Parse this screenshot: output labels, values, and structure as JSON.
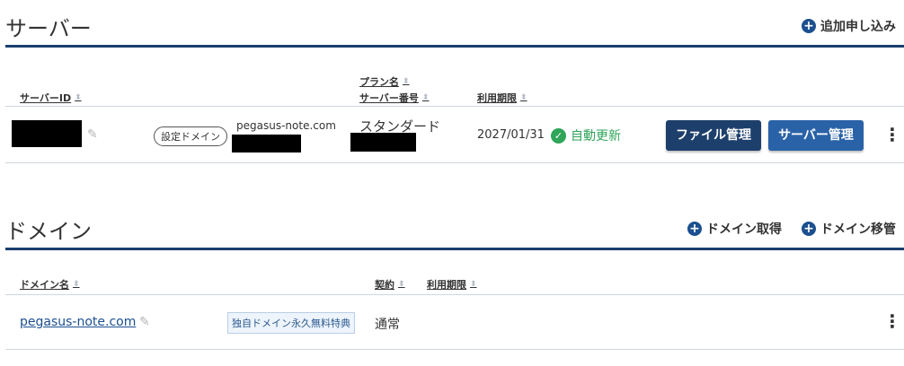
{
  "server_section": {
    "title": "サーバー",
    "add_label": "追加申し込み",
    "columns": {
      "server_id": "サーバーID",
      "plan_name": "プラン名",
      "server_number": "サーバー番号",
      "expiry": "利用期限"
    },
    "row": {
      "domain_tag": "設定ドメイン",
      "domain": "pegasus-note.com",
      "plan": "スタンダード",
      "expiry_date": "2027/01/31",
      "auto_renew": "自動更新",
      "file_button": "ファイル管理",
      "server_button": "サーバー管理"
    }
  },
  "domain_section": {
    "title": "ドメイン",
    "acquire_label": "ドメイン取得",
    "transfer_label": "ドメイン移管",
    "columns": {
      "domain_name": "ドメイン名",
      "contract": "契約",
      "expiry": "利用期限"
    },
    "row": {
      "domain": "pegasus-note.com",
      "badge": "独自ドメイン永久無料特典",
      "contract": "通常"
    }
  },
  "icons": {
    "add": "plus-circle-icon",
    "edit": "pencil-icon",
    "sort": "sort-arrows-icon",
    "check": "check-circle-icon",
    "more": "kebab-menu-icon"
  },
  "colors": {
    "accent_rule": "#1b3f6e",
    "file_button": "#1d3f6b",
    "server_button": "#2a62a8",
    "auto_renew": "#2fa55a",
    "link": "#1b4f8f"
  }
}
